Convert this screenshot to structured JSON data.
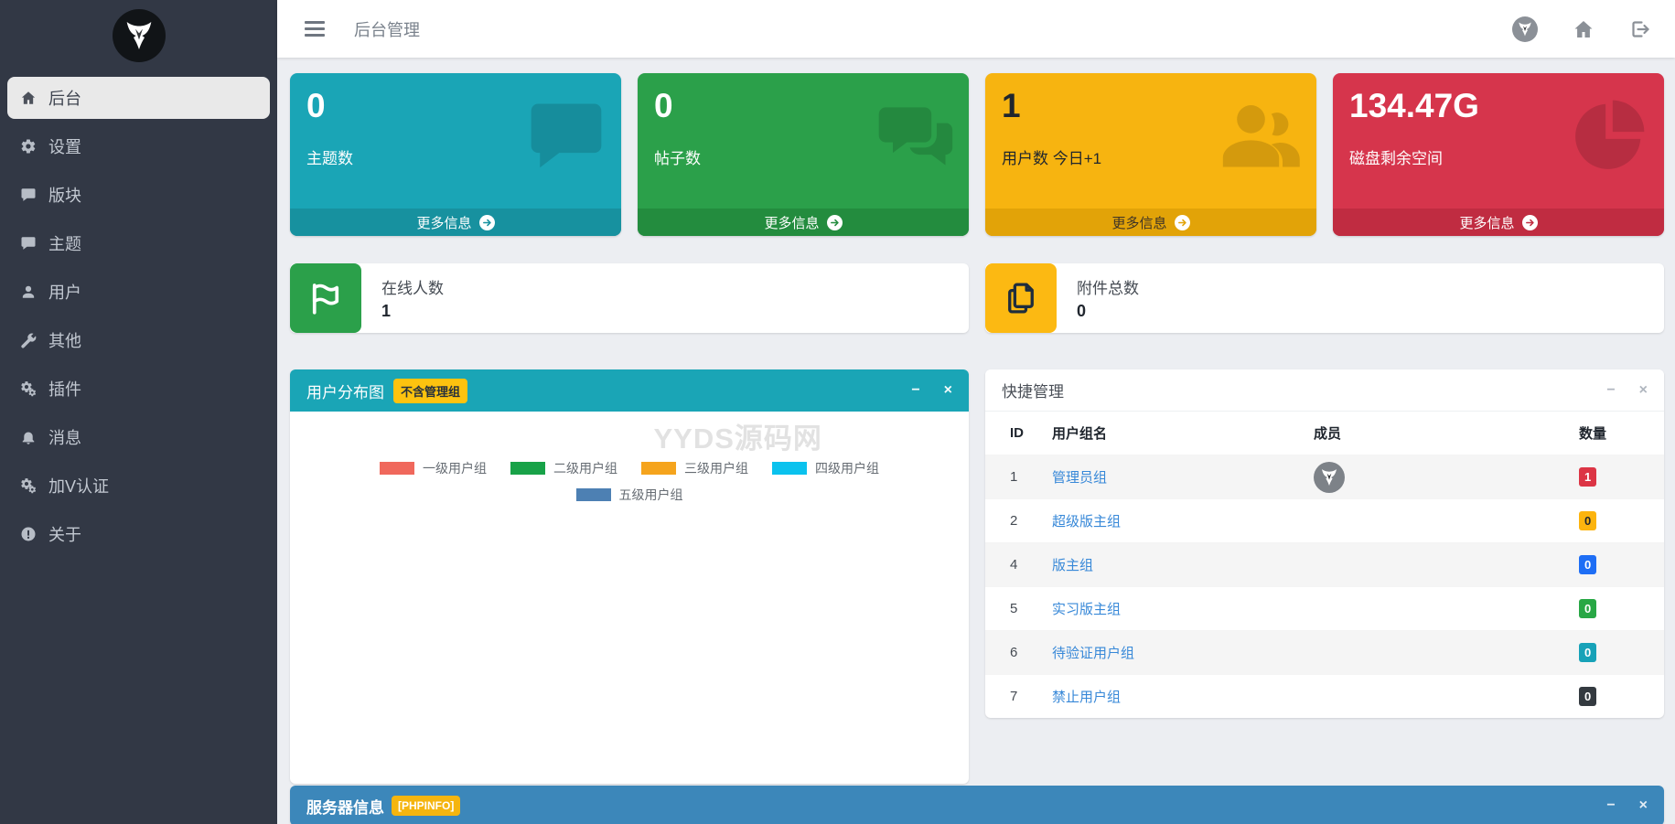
{
  "controls": {
    "minimize": "−",
    "close": "×"
  },
  "sidebar": {
    "items": [
      {
        "label": "后台",
        "icon": "home-icon",
        "active": true
      },
      {
        "label": "设置",
        "icon": "gear-icon"
      },
      {
        "label": "版块",
        "icon": "comment-icon"
      },
      {
        "label": "主题",
        "icon": "comment-icon"
      },
      {
        "label": "用户",
        "icon": "user-icon"
      },
      {
        "label": "其他",
        "icon": "wrench-icon"
      },
      {
        "label": "插件",
        "icon": "gears-icon"
      },
      {
        "label": "消息",
        "icon": "bell-icon"
      },
      {
        "label": "加V认证",
        "icon": "gears-icon"
      },
      {
        "label": "关于",
        "icon": "info-circle-icon"
      }
    ]
  },
  "topbar": {
    "title": "后台管理",
    "right_icons": [
      "fox-avatar-icon",
      "home-icon",
      "sign-out-icon"
    ]
  },
  "stat_boxes": [
    {
      "value": "0",
      "label": "主题数",
      "more_label": "更多信息",
      "icon": "comment-icon",
      "color": "#1aa5b6",
      "footer_color": "#17919f"
    },
    {
      "value": "0",
      "label": "帖子数",
      "more_label": "更多信息",
      "icon": "comments-icon",
      "color": "#2ba04a",
      "footer_color": "#238c3e"
    },
    {
      "value": "1",
      "label": "用户数 今日+1",
      "more_label": "更多信息",
      "icon": "users-icon",
      "color": "#f7b410",
      "footer_color": "#e2a308"
    },
    {
      "value": "134.47G",
      "label": "磁盘剩余空间",
      "more_label": "更多信息",
      "icon": "pie-icon",
      "color": "#d6354c",
      "footer_color": "#c02c41"
    }
  ],
  "info_boxes": [
    {
      "label": "在线人数",
      "value": "1",
      "icon": "flag-icon",
      "color": "#2ba04a"
    },
    {
      "label": "附件总数",
      "value": "0",
      "icon": "copy-icon",
      "color": "#fcb912"
    }
  ],
  "chart_panel": {
    "title": "用户分布图",
    "badge": "不含管理组",
    "header_color": "#1aa5b6",
    "watermark": "YYDS源码网",
    "legend": [
      {
        "label": "一级用户组",
        "color": "#f0685c"
      },
      {
        "label": "二级用户组",
        "color": "#18a248"
      },
      {
        "label": "三级用户组",
        "color": "#f5a41d"
      },
      {
        "label": "四级用户组",
        "color": "#0bc2ee"
      },
      {
        "label": "五级用户组",
        "color": "#4d80b3"
      }
    ]
  },
  "quick_panel": {
    "title": "快捷管理",
    "columns": [
      "ID",
      "用户组名",
      "成员",
      "数量"
    ],
    "rows": [
      {
        "id": "1",
        "name": "管理员组",
        "member_icon": "fox-avatar-icon",
        "count": "1",
        "badge_color": "#dc3545",
        "badge_text_color": "#ffffff"
      },
      {
        "id": "2",
        "name": "超级版主组",
        "member_icon": "",
        "count": "0",
        "badge_color": "#fcb40e",
        "badge_text_color": "#20262e"
      },
      {
        "id": "4",
        "name": "版主组",
        "member_icon": "",
        "count": "0",
        "badge_color": "#1e6ef5",
        "badge_text_color": "#ffffff"
      },
      {
        "id": "5",
        "name": "实习版主组",
        "member_icon": "",
        "count": "0",
        "badge_color": "#28a745",
        "badge_text_color": "#ffffff"
      },
      {
        "id": "6",
        "name": "待验证用户组",
        "member_icon": "",
        "count": "0",
        "badge_color": "#17a2b8",
        "badge_text_color": "#ffffff"
      },
      {
        "id": "7",
        "name": "禁止用户组",
        "member_icon": "",
        "count": "0",
        "badge_color": "#343a40",
        "badge_text_color": "#ffffff"
      }
    ]
  },
  "server_panel": {
    "title": "服务器信息",
    "badge": "[PHPINFO]",
    "header_color": "#3c87ba"
  }
}
